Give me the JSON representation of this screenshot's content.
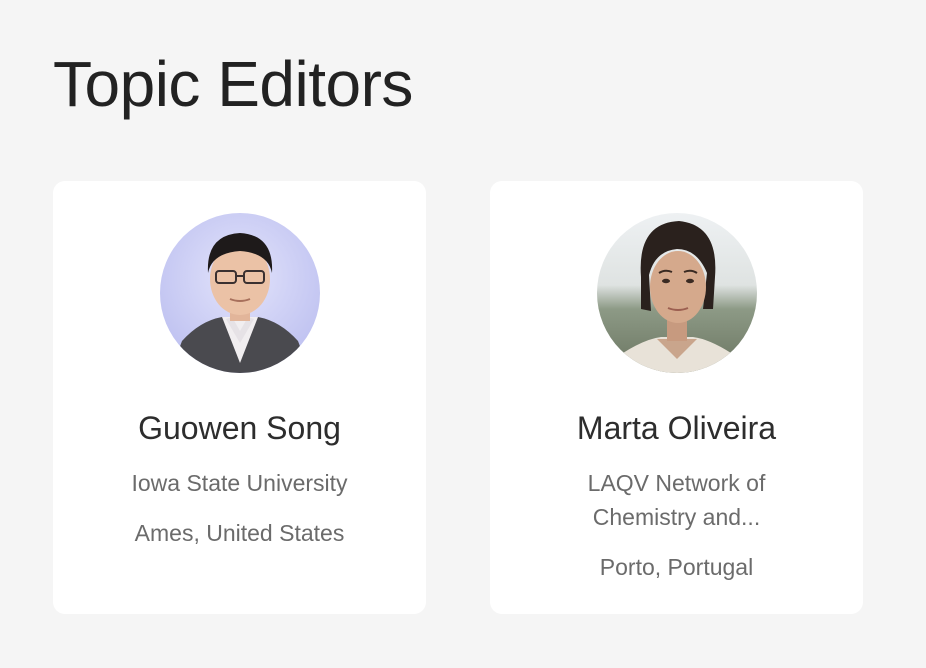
{
  "section": {
    "title": "Topic Editors"
  },
  "editors": [
    {
      "name": "Guowen Song",
      "affiliation": "Iowa State University",
      "location": "Ames, United States",
      "avatar_icon": "person-photo-icon"
    },
    {
      "name": "Marta Oliveira",
      "affiliation": "LAQV Network of Chemistry and...",
      "location": "Porto, Portugal",
      "avatar_icon": "person-photo-icon"
    }
  ],
  "colors": {
    "page_background": "#f5f5f5",
    "card_background": "#ffffff",
    "title_text": "#222222",
    "secondary_text": "#6b6b6b"
  }
}
